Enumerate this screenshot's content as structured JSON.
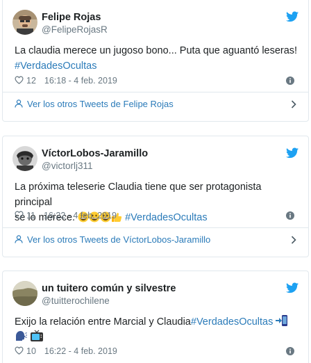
{
  "tweets": [
    {
      "display_name": "Felipe Rojas",
      "handle": "@FelipeRojasR",
      "text": "La claudia merece un jugoso bono... Puta que aguantó leseras!",
      "hashtag": "#VerdadesOcultas",
      "likes": "12",
      "timestamp": "16:18 - 4 feb. 2019",
      "more_link": "Ver los otros Tweets de Felipe Rojas"
    },
    {
      "display_name": "VíctorLobos-Jaramillo",
      "handle": "@victorlj311",
      "text_line1": "La próxima teleserie Claudia tiene que ser protagonista principal",
      "text_line2": "se lo merece.",
      "hashtag": "#VerdadesOcultas",
      "likes": "11",
      "timestamp": "16:22 - 4 feb. 2019",
      "more_link": "Ver los otros Tweets de VíctorLobos-Jaramillo"
    },
    {
      "display_name": "un tuitero común y silvestre",
      "handle": "@tuitterochilene",
      "text": "Exijo la relación entre Marcial y Claudia",
      "hashtag": "#VerdadesOcultas",
      "likes": "10",
      "timestamp": "16:22 - 4 feb. 2019"
    }
  ],
  "colors": {
    "link_blue": "#2b7bb9",
    "twitter_blue": "#1da1f2",
    "muted_gray": "#697882",
    "border": "#e1e8ed"
  },
  "icons": [
    "twitter-bird-icon",
    "heart-icon",
    "info-icon",
    "person-icon",
    "chevron-right-icon"
  ],
  "emoji": {
    "tweet2": [
      "grinning-face",
      "grinning-face",
      "grinning-face",
      "thumbs-up"
    ],
    "tweet3": [
      "mobile-phone-arrow",
      "speaking-head",
      "television"
    ]
  }
}
